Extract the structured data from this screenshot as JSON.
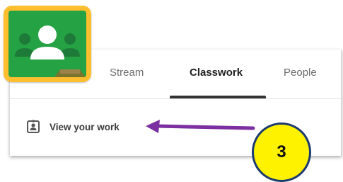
{
  "tabs": [
    {
      "label": "Stream",
      "active": false
    },
    {
      "label": "Classwork",
      "active": true
    },
    {
      "label": "People",
      "active": false
    }
  ],
  "classwork": {
    "view_your_work_label": "View your work",
    "view_your_work_icon": "assignment-ind-icon"
  },
  "annotation": {
    "step_number": "3",
    "step_badge_color": "#fff200",
    "step_badge_border": "#1d3a6e",
    "arrow_color": "#7b2fa0"
  },
  "logo": {
    "icon": "google-classroom-logo-icon",
    "colors": {
      "frame": "#ffbe2e",
      "board": "#25a244",
      "figures": "#ffffff",
      "dark_figure": "#1e7a38"
    }
  }
}
